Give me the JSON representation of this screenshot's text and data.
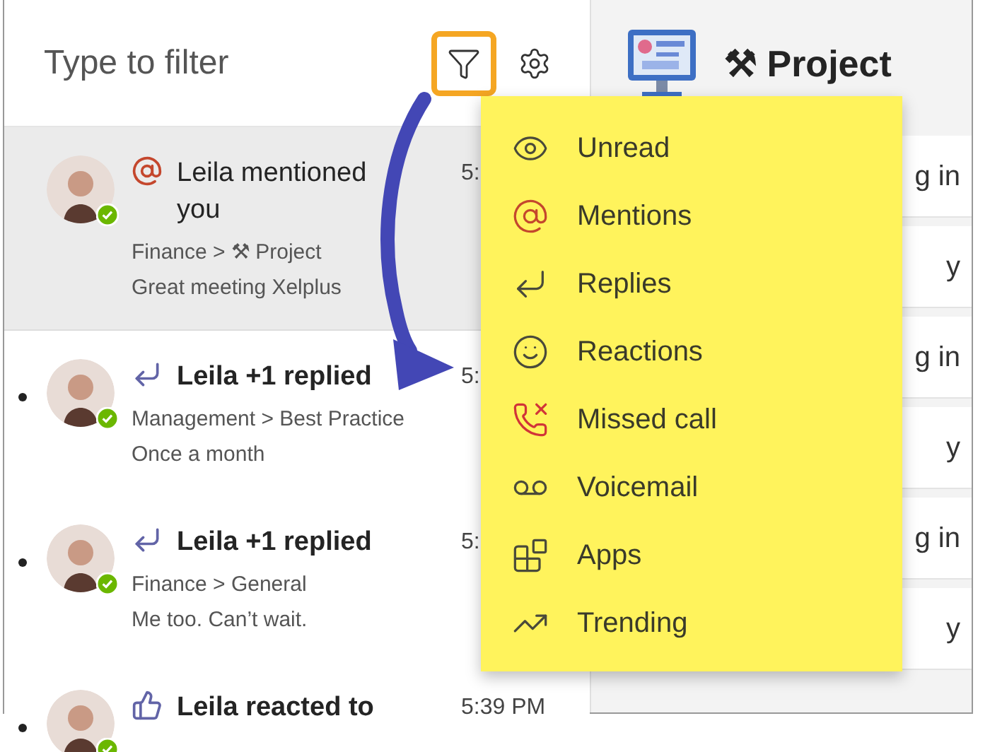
{
  "header": {
    "placeholder": "Type to filter",
    "filter_button": {
      "highlighted": true
    }
  },
  "feed": [
    {
      "kind": "mention",
      "unread": false,
      "selected": true,
      "title": "Leila mentioned you",
      "time": "5:",
      "location": "Finance > ⚒ Project",
      "preview": "Great meeting Xelplus"
    },
    {
      "kind": "reply",
      "unread": true,
      "selected": false,
      "title": "Leila +1 replied",
      "time": "5:",
      "location": "Management > Best Practice",
      "preview": "Once a month"
    },
    {
      "kind": "reply",
      "unread": true,
      "selected": false,
      "title": "Leila +1 replied",
      "time": "5:",
      "location": "Finance > General",
      "preview": "Me too. Can’t wait."
    },
    {
      "kind": "reaction",
      "unread": true,
      "selected": false,
      "title": "Leila reacted to",
      "time": "5:39 PM"
    }
  ],
  "channel": {
    "title": "⚒ Project"
  },
  "right_rows": [
    {
      "text": "g in"
    },
    {
      "text": "y"
    },
    {
      "text": "g in"
    },
    {
      "text": "y"
    },
    {
      "text": "g in"
    },
    {
      "text": "y"
    }
  ],
  "filter_menu": [
    {
      "kind": "unread",
      "label": "Unread"
    },
    {
      "kind": "mentions",
      "label": "Mentions"
    },
    {
      "kind": "replies",
      "label": "Replies"
    },
    {
      "kind": "reactions",
      "label": "Reactions"
    },
    {
      "kind": "missed_call",
      "label": "Missed call"
    },
    {
      "kind": "voicemail",
      "label": "Voicemail"
    },
    {
      "kind": "apps",
      "label": "Apps"
    },
    {
      "kind": "trending",
      "label": "Trending"
    }
  ]
}
